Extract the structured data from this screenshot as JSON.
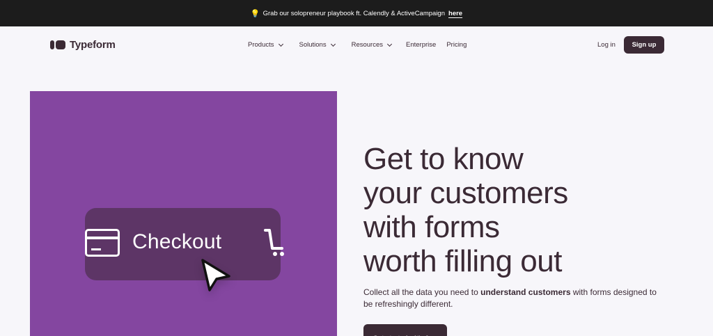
{
  "banner": {
    "text": "Grab our solopreneur playbook ft. Calendly & ActiveCampaign",
    "link": "here"
  },
  "nav": {
    "logo": "Typeform",
    "items": [
      {
        "label": "Products",
        "dropdown": true
      },
      {
        "label": "Solutions",
        "dropdown": true
      },
      {
        "label": "Resources",
        "dropdown": true
      },
      {
        "label": "Enterprise",
        "dropdown": false
      },
      {
        "label": "Pricing",
        "dropdown": false
      }
    ],
    "login": "Log in",
    "signup": "Sign up"
  },
  "hero": {
    "visual": {
      "button_text": "Checkout",
      "background": "#8446a0",
      "button_color": "#5d3566"
    },
    "title_lines": [
      "Get to know",
      "your customers",
      "with forms",
      "worth filling out"
    ],
    "subtitle_pre": "Collect all the data you need to ",
    "subtitle_bold": "understand customers",
    "subtitle_post": " with forms designed to be refreshingly different.",
    "cta": "Get started—it's free"
  },
  "colors": {
    "brand_dark": "#3b2a35",
    "banner_bg": "#1c1c1c",
    "page_bg": "#f7f6fa"
  },
  "icons": {
    "banner": "lightbulb-icon",
    "visual_left": "credit-card-icon",
    "visual_right": "shopping-cart-icon",
    "pointer": "mouse-pointer-icon"
  }
}
